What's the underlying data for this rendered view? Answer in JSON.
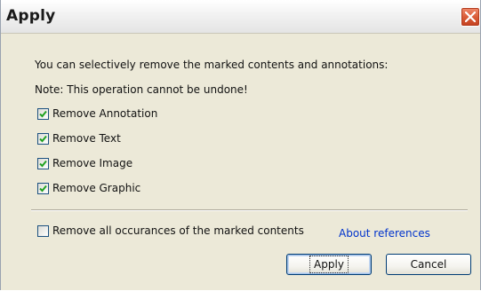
{
  "window": {
    "title": "Apply",
    "close_icon": "close-icon"
  },
  "dialog": {
    "intro_text": "You can selectively remove the marked contents and annotations:",
    "note_text": "Note: This operation cannot be undone!",
    "options": [
      {
        "label": "Remove Annotation",
        "checked": true
      },
      {
        "label": "Remove Text",
        "checked": true
      },
      {
        "label": "Remove Image",
        "checked": true
      },
      {
        "label": "Remove Graphic",
        "checked": true
      }
    ],
    "remove_all": {
      "label": "Remove all occurances of the marked contents",
      "checked": false
    },
    "about_link": "About references",
    "apply_button": "Apply",
    "cancel_button": "Cancel"
  },
  "colors": {
    "dialog_background": "#ece9d8",
    "check_mark": "#21a121",
    "link": "#0033cc",
    "close_button": "#d85a36"
  }
}
